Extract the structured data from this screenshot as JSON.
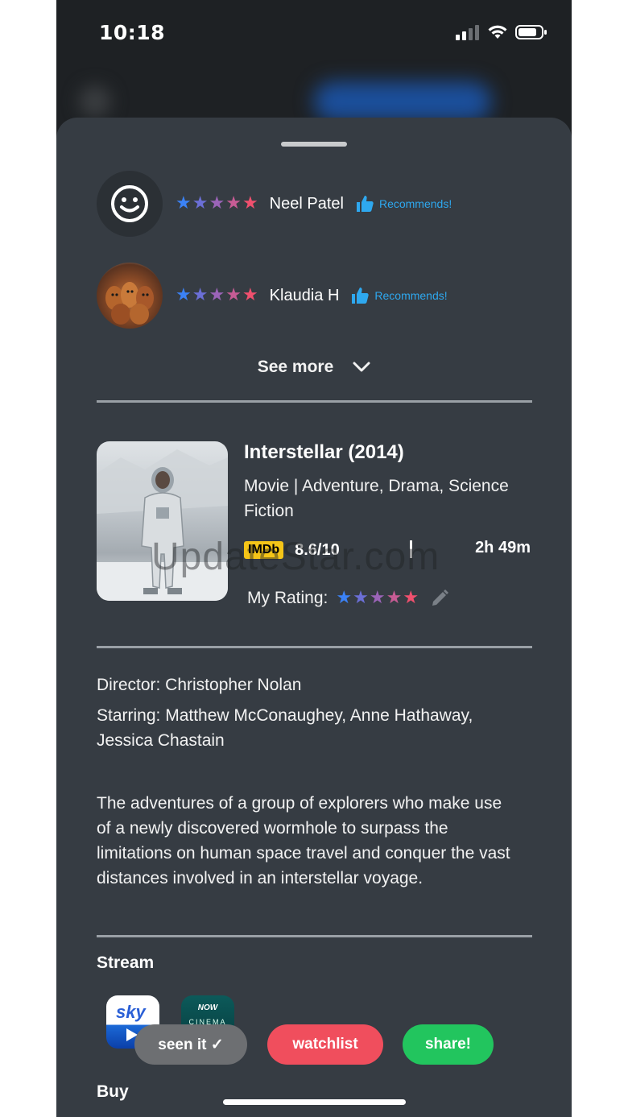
{
  "status_bar": {
    "time": "10:18"
  },
  "reviews": [
    {
      "avatar": "smiley-avatar-icon",
      "name": "Neel Patel",
      "rating_stars": 5,
      "recommend_label": "Recommends!"
    },
    {
      "avatar": "squirrels-photo-avatar",
      "name": "Klaudia H",
      "rating_stars": 5,
      "recommend_label": "Recommends!"
    }
  ],
  "see_more_label": "See more",
  "movie": {
    "title": "Interstellar (2014)",
    "genre": "Movie | Adventure, Drama, Science Fiction",
    "imdb_badge": "IMDb",
    "imdb_score": "8.6/10",
    "runtime": "2h 49m",
    "my_rating_label": "My Rating:",
    "my_rating_stars": 5,
    "director": "Director: Christopher Nolan",
    "starring": "Starring: Matthew McConaughey, Anne Hathaway, Jessica Chastain",
    "synopsis": "The adventures of a group of explorers who make use of a newly discovered wormhole to surpass the limitations on human space travel and conquer the vast distances involved in an interstellar voyage."
  },
  "watermark": "UpdateStar.com",
  "stream": {
    "heading": "Stream",
    "services": [
      {
        "name": "sky",
        "icon": "sky-go-icon"
      },
      {
        "name": "NOW",
        "subtitle": "CINEMA",
        "icon": "now-cinema-icon"
      }
    ]
  },
  "buy": {
    "heading": "Buy"
  },
  "actions": {
    "seen_label": "seen it ✓",
    "watchlist_label": "watchlist",
    "share_label": "share!"
  },
  "colors": {
    "sheet_bg": "#363c43",
    "recommend_blue": "#2ea8ef",
    "watchlist_red": "#f04e5d",
    "share_green": "#22c55e",
    "seen_gray": "#6d6f72",
    "star_gradient": [
      "#3b82f6",
      "#6b6fd6",
      "#9b64b8",
      "#c75c95",
      "#f0506e"
    ]
  }
}
